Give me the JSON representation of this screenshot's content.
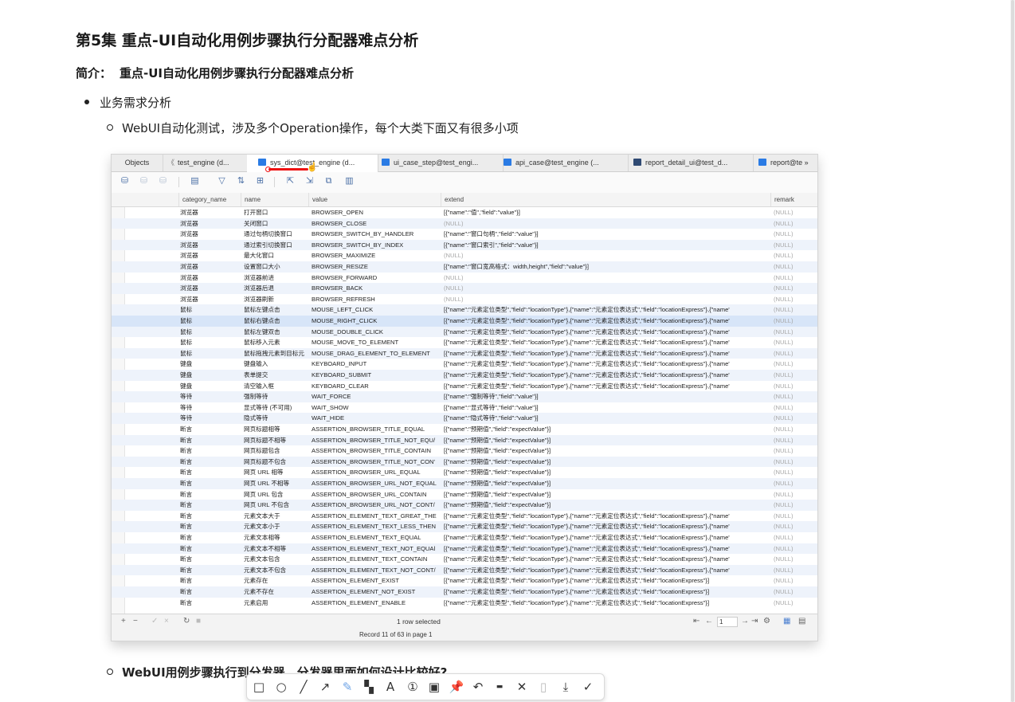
{
  "page": {
    "title": "第5集 重点-UI自动化用例步骤执行分配器难点分析",
    "intro_label": "简介：",
    "intro_text": "重点-UI自动化用例步骤执行分配器难点分析",
    "bullet_1": "业务需求分析",
    "bullet_1_1": "WebUI自动化测试，涉及多个Operation操作，每个大类下面又有很多小项",
    "bullet_2": "WebUI用例步骤执行到分发器，分发器里面如何设计比较好?"
  },
  "db_window": {
    "tabs": [
      {
        "label": "Objects",
        "nav": "",
        "icon": false,
        "active": false
      },
      {
        "label": "test_engine (d...",
        "nav": "《",
        "icon": false,
        "active": false
      },
      {
        "label": "sys_dict@test_engine (d...",
        "nav": "",
        "icon": true,
        "active": true
      },
      {
        "label": "ui_case_step@test_engi...",
        "nav": "",
        "icon": true,
        "active": false
      },
      {
        "label": "api_case@test_engine (...",
        "nav": "",
        "icon": true,
        "active": false
      },
      {
        "label": "report_detail_ui@test_d...",
        "nav": "",
        "icon": true,
        "active": false
      },
      {
        "label": "report@te »",
        "nav": "",
        "icon": true,
        "active": false
      }
    ],
    "columns": [
      "category_name",
      "name",
      "value",
      "extend",
      "remark"
    ],
    "rows": [
      [
        "浏览器",
        "打开窗口",
        "BROWSER_OPEN",
        "[{\"name\":\"值\",\"field\":\"value\"}]",
        "(NULL)"
      ],
      [
        "浏览器",
        "关闭窗口",
        "BROWSER_CLOSE",
        "(NULL)",
        "(NULL)"
      ],
      [
        "浏览器",
        "通过句柄切换窗口",
        "BROWSER_SWITCH_BY_HANDLER",
        "[{\"name\":\"窗口句柄\",\"field\":\"value\"}]",
        "(NULL)"
      ],
      [
        "浏览器",
        "通过索引切换窗口",
        "BROWSER_SWITCH_BY_INDEX",
        "[{\"name\":\"窗口索引\",\"field\":\"value\"}]",
        "(NULL)"
      ],
      [
        "浏览器",
        "最大化窗口",
        "BROWSER_MAXIMIZE",
        "(NULL)",
        "(NULL)"
      ],
      [
        "浏览器",
        "设置窗口大小",
        "BROWSER_RESIZE",
        "[{\"name\":\"窗口宽高格式：width,height\",\"field\":\"value\"}]",
        "(NULL)"
      ],
      [
        "浏览器",
        "浏览器前进",
        "BROWSER_FORWARD",
        "(NULL)",
        "(NULL)"
      ],
      [
        "浏览器",
        "浏览器后退",
        "BROWSER_BACK",
        "(NULL)",
        "(NULL)"
      ],
      [
        "浏览器",
        "浏览器刷新",
        "BROWSER_REFRESH",
        "(NULL)",
        "(NULL)"
      ],
      [
        "鼠标",
        "鼠标左键点击",
        "MOUSE_LEFT_CLICK",
        "[{\"name\":\"元素定位类型\",\"field\":\"locationType\"},{\"name\":\"元素定位表达式\",\"field\":\"locationExpress\"},{\"name'",
        "(NULL)"
      ],
      [
        "鼠标",
        "鼠标右键点击",
        "MOUSE_RIGHT_CLICK",
        "[{\"name\":\"元素定位类型\",\"field\":\"locationType\"},{\"name\":\"元素定位表达式\",\"field\":\"locationExpress\"},{\"name'",
        "(NULL)"
      ],
      [
        "鼠标",
        "鼠标左键双击",
        "MOUSE_DOUBLE_CLICK",
        "[{\"name\":\"元素定位类型\",\"field\":\"locationType\"},{\"name\":\"元素定位表达式\",\"field\":\"locationExpress\"},{\"name'",
        "(NULL)"
      ],
      [
        "鼠标",
        "鼠标移入元素",
        "MOUSE_MOVE_TO_ELEMENT",
        "[{\"name\":\"元素定位类型\",\"field\":\"locationType\"},{\"name\":\"元素定位表达式\",\"field\":\"locationExpress\"},{\"name'",
        "(NULL)"
      ],
      [
        "鼠标",
        "鼠标拖拽元素到目标元",
        "MOUSE_DRAG_ELEMENT_TO_ELEMENT",
        "[{\"name\":\"元素定位类型\",\"field\":\"locationType\"},{\"name\":\"元素定位表达式\",\"field\":\"locationExpress\"},{\"name'",
        "(NULL)"
      ],
      [
        "键盘",
        "键盘输入",
        "KEYBOARD_INPUT",
        "[{\"name\":\"元素定位类型\",\"field\":\"locationType\"},{\"name\":\"元素定位表达式\",\"field\":\"locationExpress\"},{\"name'",
        "(NULL)"
      ],
      [
        "键盘",
        "表单提交",
        "KEYBOARD_SUBMIT",
        "[{\"name\":\"元素定位类型\",\"field\":\"locationType\"},{\"name\":\"元素定位表达式\",\"field\":\"locationExpress\"},{\"name'",
        "(NULL)"
      ],
      [
        "键盘",
        "清空输入框",
        "KEYBOARD_CLEAR",
        "[{\"name\":\"元素定位类型\",\"field\":\"locationType\"},{\"name\":\"元素定位表达式\",\"field\":\"locationExpress\"},{\"name'",
        "(NULL)"
      ],
      [
        "等待",
        "强制等待",
        "WAIT_FORCE",
        "[{\"name\":\"强制等待\",\"field\":\"value\"}]",
        "(NULL)"
      ],
      [
        "等待",
        "显式等待 (不可用)",
        "WAIT_SHOW",
        "[{\"name\":\"显式等待\",\"field\":\"value\"}]",
        "(NULL)"
      ],
      [
        "等待",
        "隐式等待",
        "WAIT_HIDE",
        "[{\"name\":\"隐式等待\",\"field\":\"value\"}]",
        "(NULL)"
      ],
      [
        "断言",
        "网页标题相等",
        "ASSERTION_BROWSER_TITLE_EQUAL",
        "[{\"name\":\"预期值\",\"field\":\"expectValue\"}]",
        "(NULL)"
      ],
      [
        "断言",
        "网页标题不相等",
        "ASSERTION_BROWSER_TITLE_NOT_EQU/",
        "[{\"name\":\"预期值\",\"field\":\"expectValue\"}]",
        "(NULL)"
      ],
      [
        "断言",
        "网页标题包含",
        "ASSERTION_BROWSER_TITLE_CONTAIN",
        "[{\"name\":\"预期值\",\"field\":\"expectValue\"}]",
        "(NULL)"
      ],
      [
        "断言",
        "网页标题不包含",
        "ASSERTION_BROWSER_TITLE_NOT_CON'",
        "[{\"name\":\"预期值\",\"field\":\"expectValue\"}]",
        "(NULL)"
      ],
      [
        "断言",
        "网页 URL 相等",
        "ASSERTION_BROWSER_URL_EQUAL",
        "[{\"name\":\"预期值\",\"field\":\"expectValue\"}]",
        "(NULL)"
      ],
      [
        "断言",
        "网页 URL 不相等",
        "ASSERTION_BROWSER_URL_NOT_EQUAL",
        "[{\"name\":\"预期值\",\"field\":\"expectValue\"}]",
        "(NULL)"
      ],
      [
        "断言",
        "网页 URL 包含",
        "ASSERTION_BROWSER_URL_CONTAIN",
        "[{\"name\":\"预期值\",\"field\":\"expectValue\"}]",
        "(NULL)"
      ],
      [
        "断言",
        "网页 URL 不包含",
        "ASSERTION_BROWSER_URL_NOT_CONT/",
        "[{\"name\":\"预期值\",\"field\":\"expectValue\"}]",
        "(NULL)"
      ],
      [
        "断言",
        "元素文本大于",
        "ASSERTION_ELEMENT_TEXT_GREAT_THE",
        "[{\"name\":\"元素定位类型\",\"field\":\"locationType\"},{\"name\":\"元素定位表达式\",\"field\":\"locationExpress\"},{\"name'",
        "(NULL)"
      ],
      [
        "断言",
        "元素文本小于",
        "ASSERTION_ELEMENT_TEXT_LESS_THEN",
        "[{\"name\":\"元素定位类型\",\"field\":\"locationType\"},{\"name\":\"元素定位表达式\",\"field\":\"locationExpress\"},{\"name'",
        "(NULL)"
      ],
      [
        "断言",
        "元素文本相等",
        "ASSERTION_ELEMENT_TEXT_EQUAL",
        "[{\"name\":\"元素定位类型\",\"field\":\"locationType\"},{\"name\":\"元素定位表达式\",\"field\":\"locationExpress\"},{\"name'",
        "(NULL)"
      ],
      [
        "断言",
        "元素文本不相等",
        "ASSERTION_ELEMENT_TEXT_NOT_EQUAl",
        "[{\"name\":\"元素定位类型\",\"field\":\"locationType\"},{\"name\":\"元素定位表达式\",\"field\":\"locationExpress\"},{\"name'",
        "(NULL)"
      ],
      [
        "断言",
        "元素文本包含",
        "ASSERTION_ELEMENT_TEXT_CONTAIN",
        "[{\"name\":\"元素定位类型\",\"field\":\"locationType\"},{\"name\":\"元素定位表达式\",\"field\":\"locationExpress\"},{\"name'",
        "(NULL)"
      ],
      [
        "断言",
        "元素文本不包含",
        "ASSERTION_ELEMENT_TEXT_NOT_CONT/",
        "[{\"name\":\"元素定位类型\",\"field\":\"locationType\"},{\"name\":\"元素定位表达式\",\"field\":\"locationExpress\"},{\"name'",
        "(NULL)"
      ],
      [
        "断言",
        "元素存在",
        "ASSERTION_ELEMENT_EXIST",
        "[{\"name\":\"元素定位类型\",\"field\":\"locationType\"},{\"name\":\"元素定位表达式\",\"field\":\"locationExpress\"}]",
        "(NULL)"
      ],
      [
        "断言",
        "元素不存在",
        "ASSERTION_ELEMENT_NOT_EXIST",
        "[{\"name\":\"元素定位类型\",\"field\":\"locationType\"},{\"name\":\"元素定位表达式\",\"field\":\"locationExpress\"}]",
        "(NULL)"
      ],
      [
        "断言",
        "元素启用",
        "ASSERTION_ELEMENT_ENABLE",
        "[{\"name\":\"元素定位类型\",\"field\":\"locationType\"},{\"name\":\"元素定位表达式\",\"field\":\"locationExpress\"}]",
        "(NULL)"
      ]
    ],
    "selected_row_index": 10,
    "status": {
      "selection": "1 row selected",
      "record": "Record 11 of 63 in page 1",
      "page_number": "1"
    }
  },
  "annotation_toolbar": {
    "tools": [
      "rect-icon",
      "ellipse-icon",
      "line-icon",
      "arrow-icon",
      "pen-icon",
      "mosaic-icon",
      "text-icon",
      "number-icon",
      "blur-icon",
      "pin-icon",
      "undo-icon",
      "ocr-icon",
      "close-icon",
      "clipboard-icon",
      "download-icon",
      "confirm-icon"
    ]
  }
}
